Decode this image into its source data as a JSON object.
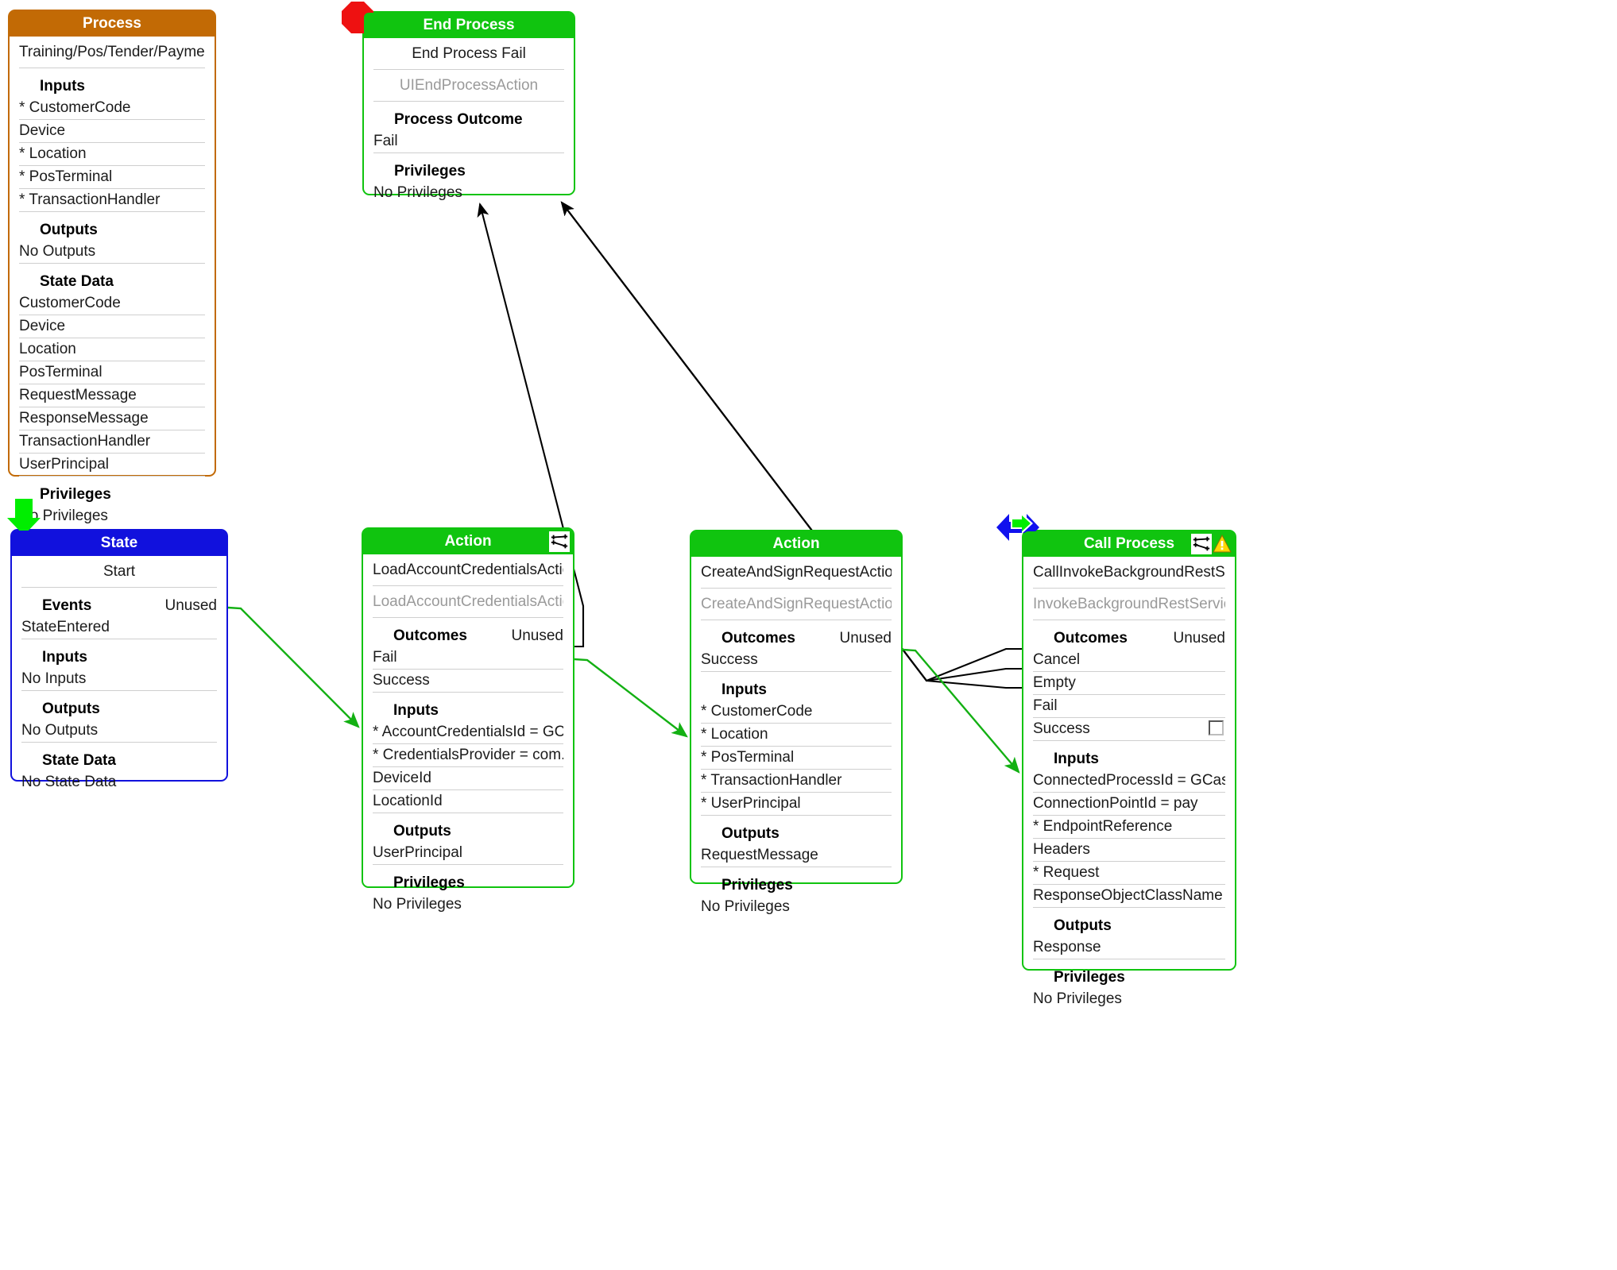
{
  "diagram": {
    "kind": "process-flow-diagram",
    "colors": {
      "process_header": "#c26a05",
      "green_header": "#10c40f",
      "state_header": "#1111dd",
      "stop_badge": "#ee1111",
      "green_edge": "#13b013",
      "black_edge": "#000000",
      "warning": "#ffd700",
      "muted_text": "#9a9a9a",
      "divider": "#cfcfcf"
    }
  },
  "process": {
    "header": "Process",
    "path": "Training/Pos/Tender/PaymentServ...",
    "inputs_label": "Inputs",
    "inputs": [
      "* CustomerCode",
      "Device",
      "* Location",
      "* PosTerminal",
      "* TransactionHandler"
    ],
    "outputs_label": "Outputs",
    "outputs": [
      "No Outputs"
    ],
    "state_data_label": "State Data",
    "state_data": [
      "CustomerCode",
      "Device",
      "Location",
      "PosTerminal",
      "RequestMessage",
      "ResponseMessage",
      "TransactionHandler",
      "UserPrincipal"
    ],
    "privileges_label": "Privileges",
    "privileges": [
      "No Privileges"
    ]
  },
  "end_process": {
    "header": "End Process",
    "title": "End Process Fail",
    "subtitle": "UIEndProcessAction",
    "outcome_label": "Process Outcome",
    "outcome": [
      "Fail"
    ],
    "privileges_label": "Privileges",
    "privileges": [
      "No Privileges"
    ],
    "badge": "stop-octagon-icon"
  },
  "state": {
    "header": "State",
    "title": "Start",
    "events_label": "Events",
    "events_note": "Unused",
    "events": [
      "StateEntered"
    ],
    "inputs_label": "Inputs",
    "inputs": [
      "No Inputs"
    ],
    "outputs_label": "Outputs",
    "outputs": [
      "No Outputs"
    ],
    "state_data_label": "State Data",
    "state_data": [
      "No State Data"
    ],
    "badge": "green-down-arrow-icon"
  },
  "action1": {
    "header": "Action",
    "title": "LoadAccountCredentialsAction",
    "subtitle": "LoadAccountCredentialsAction",
    "outcomes_label": "Outcomes",
    "outcomes_note": "Unused",
    "outcomes": [
      "Fail",
      "Success"
    ],
    "inputs_label": "Inputs",
    "inputs": [
      "* AccountCredentialsId = GCASH...",
      "* CredentialsProvider = com.enac...",
      "DeviceId",
      "LocationId"
    ],
    "outputs_label": "Outputs",
    "outputs": [
      "UserPrincipal"
    ],
    "privileges_label": "Privileges",
    "privileges": [
      "No Privileges"
    ],
    "header_icon": "graph-nodes-icon"
  },
  "action2": {
    "header": "Action",
    "title": "CreateAndSignRequestAction",
    "subtitle": "CreateAndSignRequestAction",
    "outcomes_label": "Outcomes",
    "outcomes_note": "Unused",
    "outcomes": [
      "Success"
    ],
    "inputs_label": "Inputs",
    "inputs": [
      "* CustomerCode",
      "* Location",
      "* PosTerminal",
      "* TransactionHandler",
      "* UserPrincipal"
    ],
    "outputs_label": "Outputs",
    "outputs": [
      "RequestMessage"
    ],
    "privileges_label": "Privileges",
    "privileges": [
      "No Privileges"
    ]
  },
  "call_process": {
    "header": "Call Process",
    "title": "CallInvokeBackgroundRestService",
    "subtitle": "InvokeBackgroundRestService",
    "outcomes_label": "Outcomes",
    "outcomes_note": "Unused",
    "outcomes": [
      "Cancel",
      "Empty",
      "Fail",
      "Success"
    ],
    "success_checkbox": "unchecked",
    "inputs_label": "Inputs",
    "inputs": [
      "ConnectedProcessId = GCash",
      "ConnectionPointId = pay",
      "* EndpointReference",
      "Headers",
      "* Request",
      "ResponseObjectClassName = co..."
    ],
    "outputs_label": "Outputs",
    "outputs": [
      "Response"
    ],
    "privileges_label": "Privileges",
    "privileges": [
      "No Privileges"
    ],
    "header_icons": [
      "graph-nodes-icon",
      "warning-triangle-icon"
    ],
    "badge": "blue-green-dual-arrow-icon"
  },
  "edges": [
    {
      "from": "state.events",
      "to": "action1.inputs",
      "color": "green"
    },
    {
      "from": "action1.outcomes.Success",
      "to": "action2.inputs",
      "color": "green"
    },
    {
      "from": "action2.outcomes.Success",
      "to": "call_process.inputs",
      "color": "green"
    },
    {
      "from": "action1.outcomes.Fail",
      "to": "end_process",
      "color": "black"
    },
    {
      "from": "call_process.outcomes.Cancel",
      "to": "end_process",
      "color": "black"
    },
    {
      "from": "call_process.outcomes.Empty",
      "to": "end_process",
      "color": "black"
    },
    {
      "from": "call_process.outcomes.Fail",
      "to": "end_process",
      "color": "black"
    }
  ]
}
